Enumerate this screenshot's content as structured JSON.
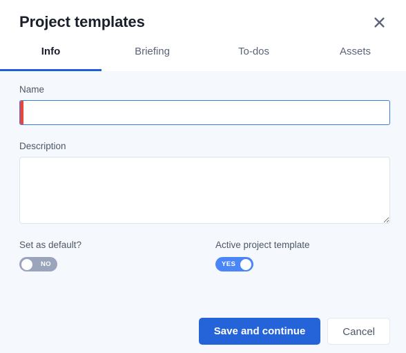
{
  "header": {
    "title": "Project templates",
    "close_icon": "close-icon"
  },
  "tabs": [
    {
      "label": "Info",
      "active": true
    },
    {
      "label": "Briefing",
      "active": false
    },
    {
      "label": "To-dos",
      "active": false
    },
    {
      "label": "Assets",
      "active": false
    }
  ],
  "form": {
    "name": {
      "label": "Name",
      "value": "",
      "placeholder": "",
      "required": true
    },
    "description": {
      "label": "Description",
      "value": "",
      "placeholder": ""
    },
    "set_as_default": {
      "label": "Set as default?",
      "state": "NO"
    },
    "active_project_template": {
      "label": "Active project template",
      "state": "YES"
    }
  },
  "footer": {
    "primary_label": "Save and continue",
    "secondary_label": "Cancel"
  },
  "colors": {
    "accent": "#2563d9",
    "tab_underline": "#1e5fd8",
    "toggle_on": "#4a86f7",
    "toggle_off": "#9aa4bb",
    "required_marker": "#e8453c",
    "input_focus_border": "#3b7ddd",
    "body_background": "#f5f8fc",
    "header_background": "#ffffff"
  }
}
